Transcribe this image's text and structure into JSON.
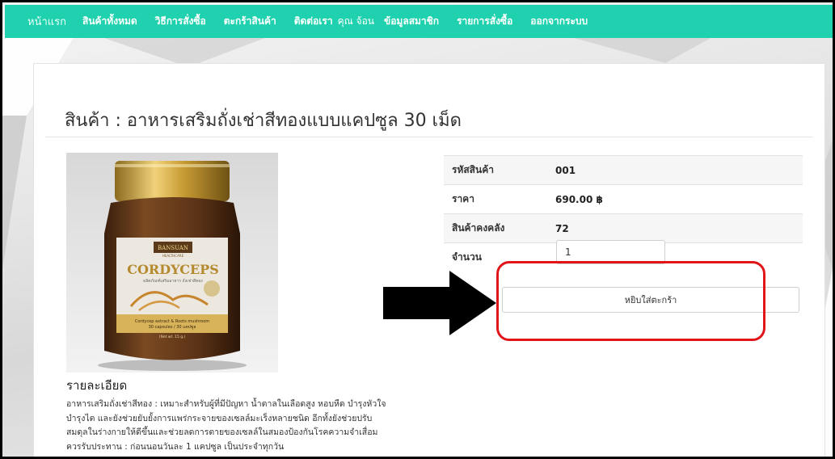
{
  "navbar": {
    "items": [
      {
        "label": "หน้าแรก"
      },
      {
        "label": "สินค้าทั้งหมด"
      },
      {
        "label": "วิธีการสั่งซื้อ"
      },
      {
        "label": "ตะกร้าสินค้า"
      },
      {
        "label": "ติดต่อเรา"
      },
      {
        "label": "คุณ จ้อน"
      },
      {
        "label": "ข้อมูลสมาชิก"
      },
      {
        "label": "รายการสั่งซื้อ"
      },
      {
        "label": "ออกจากระบบ"
      }
    ],
    "color": "#1fd1ae"
  },
  "product": {
    "title": "สินค้า : อาหารเสริมถั่งเช่าสีทองแบบแคปซูล 30 เม็ด",
    "image_label_brand": "BANSUAN",
    "image_label_brand_sub": "HEALTHCARE",
    "image_label_name": "CORDYCEPS",
    "image_label_thai": "ผลิตภัณฑ์เสริมอาหาร ถั่งเช่าสีทอง",
    "image_label_sub": "Cordycep extract & Roots mushroom",
    "image_label_caps": "30 capsules / 30 แคปซูล",
    "image_label_net": "(Net wt. 15 g.)",
    "details_heading": "รายละเอียด",
    "details_lines": [
      "อาหารเสริมถั่งเช่าสีทอง : เหมาะสำหรับผู้ที่มีปัญหา น้ำตาลในเลือดสูง หอบหืด บำรุงหัวใจ",
      "บำรุงไต และยังช่วยยับยั้งการแพร่กระจายของเซลล์มะเร็งหลายชนิด อีกทั้งยังช่วยปรับ",
      "สมดุลในร่างกายให้ดีขึ้นและช่วยลดการตายของเซลล์ในสมองป้องกันโรคความจำเสื่อม",
      "ควรรับประทาน : ก่อนนอนวันละ 1 แคปซูล เป็นประจำทุกวัน"
    ]
  },
  "info": {
    "code_label": "รหัสสินค้า",
    "code_value": "001",
    "price_label": "ราคา",
    "price_value": "690.00 ฿",
    "stock_label": "สินค้าคงคลัง",
    "stock_value": "72",
    "qty_label": "จำนวน",
    "qty_value": "1"
  },
  "cart_button_label": "หยิบใส่ตะกร้า",
  "annotation_color": "#e1161a"
}
